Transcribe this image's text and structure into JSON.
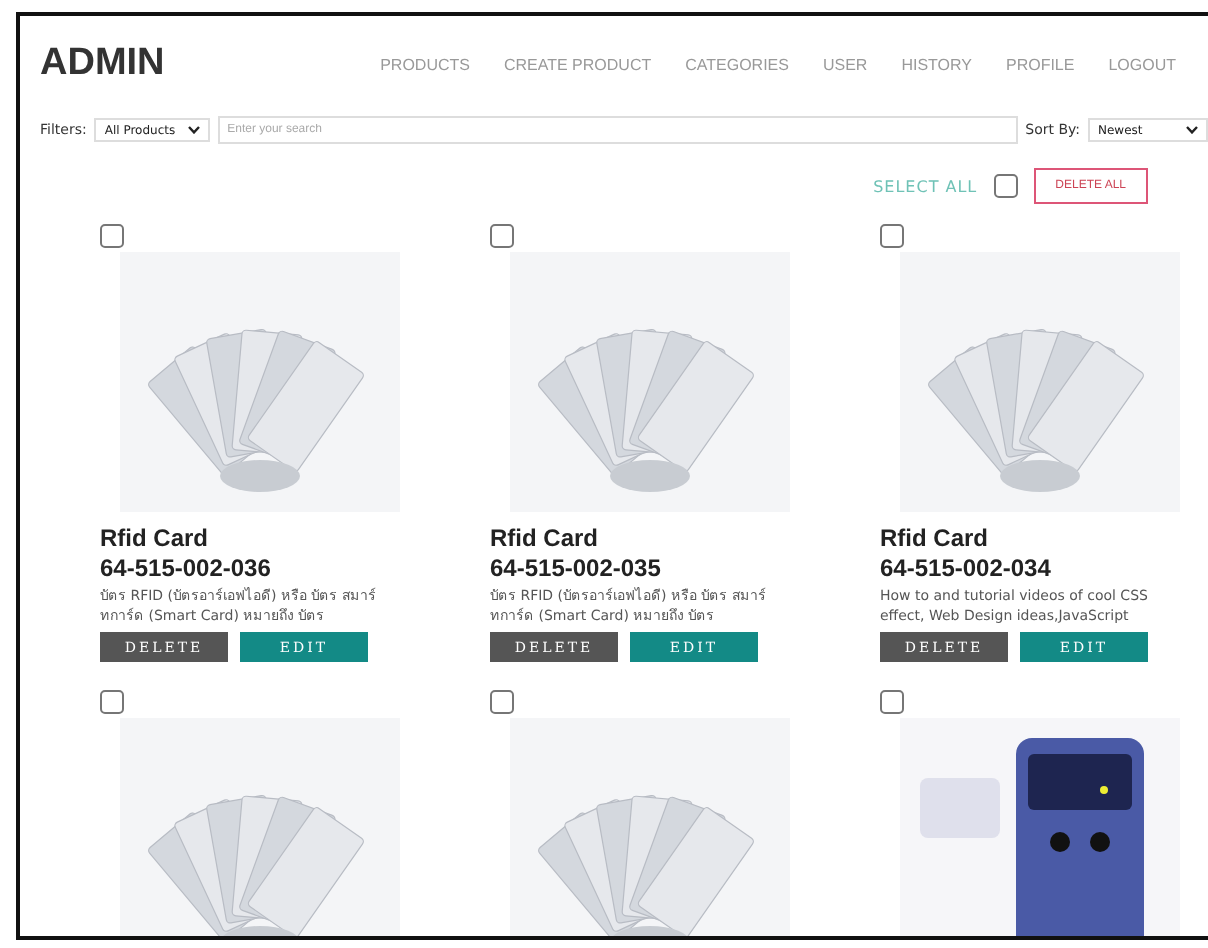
{
  "brand": "ADMIN",
  "nav": [
    "PRODUCTS",
    "CREATE PRODUCT",
    "CATEGORIES",
    "USER",
    "HISTORY",
    "PROFILE",
    "LOGOUT"
  ],
  "filters": {
    "label": "Filters:",
    "category": "All Products",
    "search_placeholder": "Enter your search",
    "sort_label": "Sort By:",
    "sort": "Newest"
  },
  "select_all": {
    "label": "SELECT ALL",
    "checked": false
  },
  "delete_all": "DELETE ALL",
  "products": [
    {
      "checked": false,
      "title": "Rfid Card",
      "code": "64-515-002-036",
      "description": "บัตร RFID (บัตรอาร์เอฟไอดี) หรือ บัตร สมาร์ทการ์ด (Smart Card) หมายถึง บัตร",
      "delete": "DELETE",
      "edit": "EDIT"
    },
    {
      "checked": false,
      "title": "Rfid Card",
      "code": "64-515-002-035",
      "description": "บัตร RFID (บัตรอาร์เอฟไอดี) หรือ บัตร สมาร์ทการ์ด (Smart Card) หมายถึง บัตร",
      "delete": "DELETE",
      "edit": "EDIT"
    },
    {
      "checked": false,
      "title": "Rfid Card",
      "code": "64-515-002-034",
      "description": "How to and tutorial videos of cool CSS effect, Web Design ideas,JavaScript",
      "delete": "DELETE",
      "edit": "EDIT"
    },
    {
      "checked": false
    },
    {
      "checked": false
    },
    {
      "checked": false
    }
  ]
}
